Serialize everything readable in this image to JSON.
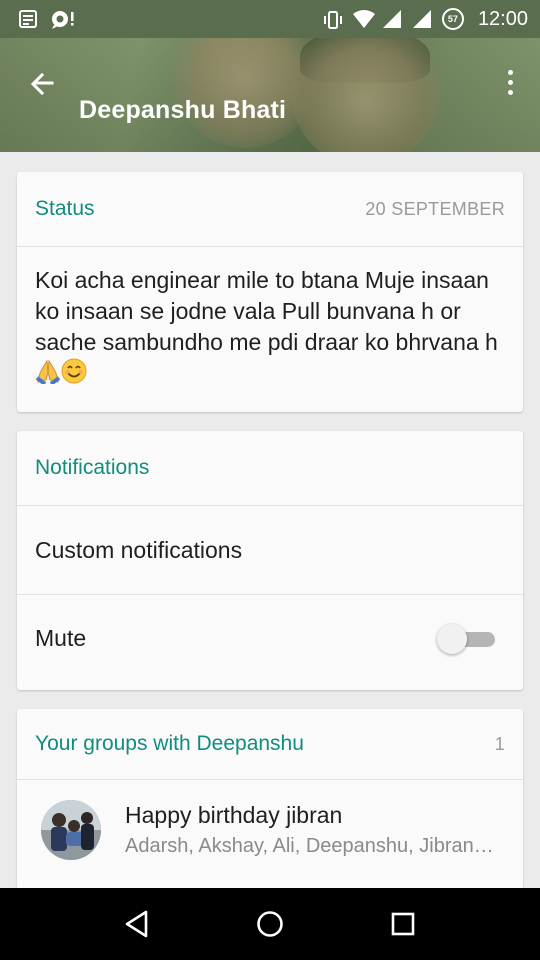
{
  "status_bar": {
    "time": "12:00",
    "battery_level": "57",
    "icons": [
      "notes-icon",
      "chat-bubble-icon",
      "vibrate-icon",
      "wifi-icon",
      "signal-icon",
      "signal-icon",
      "battery-icon"
    ]
  },
  "header": {
    "title": "Deepanshu Bhati",
    "back_icon": "arrow-left-icon",
    "menu_icon": "more-vert-icon"
  },
  "status_card": {
    "title": "Status",
    "date": "20 SEPTEMBER",
    "text": "Koi acha enginear mile to btana Muje insaan ko insaan se  jodne vala Pull bunvana h or sache sambundho me pdi draar ko bhrvana h ",
    "emojis": [
      "folded-hands-emoji",
      "smiling-face-emoji"
    ]
  },
  "notifications_card": {
    "title": "Notifications",
    "custom_label": "Custom notifications",
    "mute_label": "Mute",
    "mute_on": false
  },
  "groups_card": {
    "title": "Your groups with Deepanshu",
    "count": "1",
    "groups": [
      {
        "name": "Happy birthday jibran",
        "members": "Adarsh, Akshay, Ali, Deepanshu, Jibran, ..."
      }
    ]
  },
  "nav_bar": {
    "icons": [
      "back-triangle-icon",
      "home-circle-icon",
      "recents-square-icon"
    ]
  },
  "colors": {
    "accent": "#128c7e",
    "header_tint": "#6f8560",
    "background": "#ebebeb"
  }
}
